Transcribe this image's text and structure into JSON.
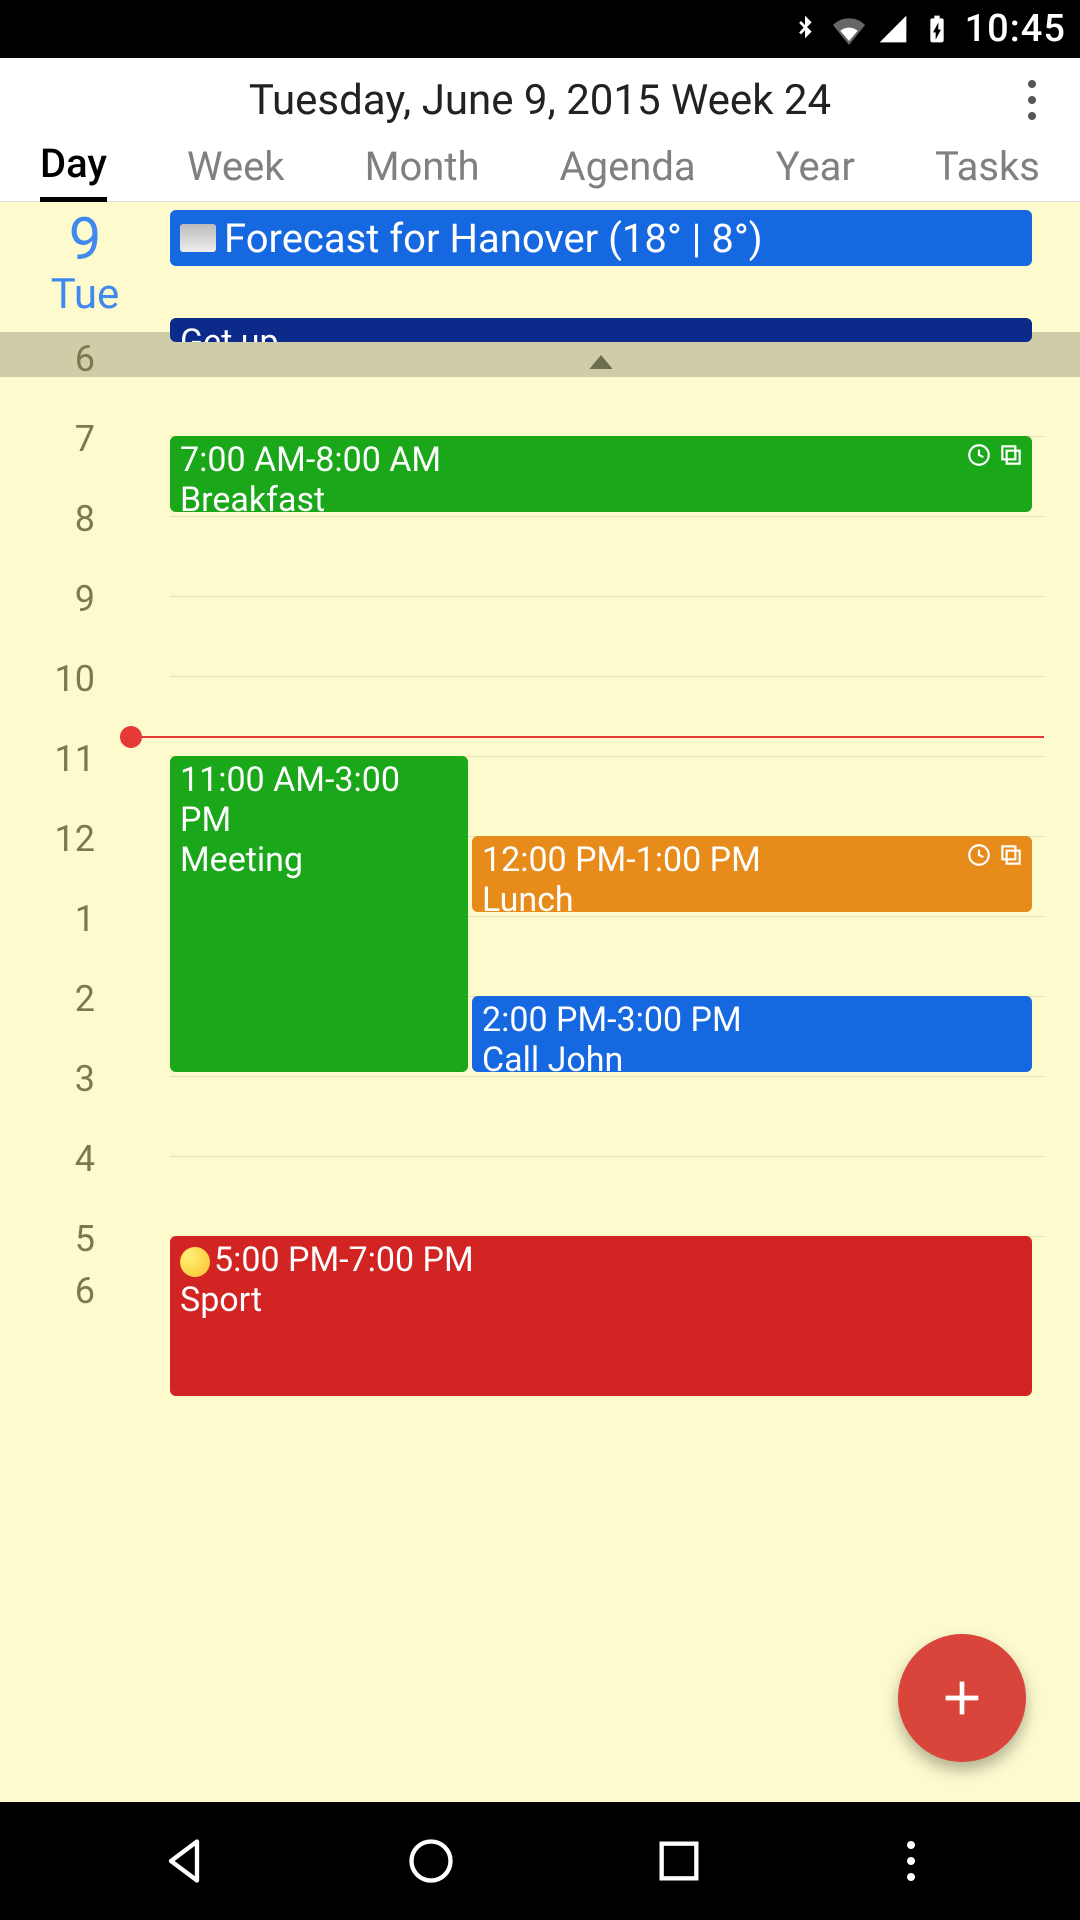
{
  "statusbar": {
    "time": "10:45"
  },
  "header": {
    "title": "Tuesday, June 9, 2015 Week 24"
  },
  "tabs": {
    "items": [
      "Day",
      "Week",
      "Month",
      "Agenda",
      "Year",
      "Tasks"
    ],
    "active": "Day"
  },
  "date": {
    "num": "9",
    "name": "Tue"
  },
  "forecast": {
    "label": "Forecast for Hanover (18° | 8°)"
  },
  "hours": [
    "6",
    "7",
    "8",
    "9",
    "10",
    "11",
    "12",
    "1",
    "2",
    "3",
    "4",
    "5",
    "6"
  ],
  "now_label": "10:45",
  "events": {
    "getup": {
      "title": "Get up"
    },
    "breakfast": {
      "time": "7:00 AM-8:00 AM",
      "title": "Breakfast"
    },
    "meeting": {
      "time": "11:00 AM-3:00 PM",
      "title": "Meeting"
    },
    "lunch": {
      "time": "12:00 PM-1:00 PM",
      "title": "Lunch"
    },
    "calljohn": {
      "time": "2:00 PM-3:00 PM",
      "title": "Call John"
    },
    "sport": {
      "time": "5:00 PM-7:00 PM",
      "title": "Sport"
    }
  },
  "colors": {
    "bg": "#fdfbce",
    "accent_blue": "#4189ef",
    "now": "#e53935",
    "fab": "#d9453a"
  }
}
